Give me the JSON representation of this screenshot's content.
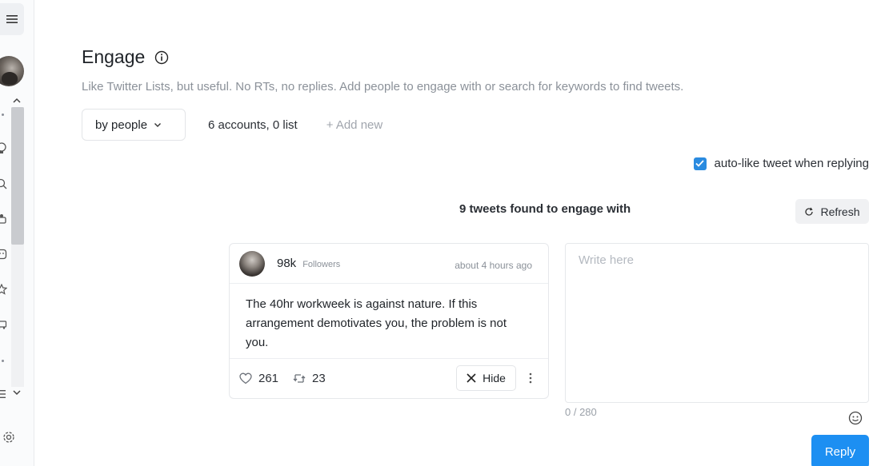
{
  "sidebar": {
    "menu_icon": "hamburger-icon",
    "icons": [
      "lightbulb-icon",
      "search-icon",
      "users-icon",
      "smile-icon",
      "star-icon",
      "truck-icon",
      "list-icon",
      "gear-icon"
    ]
  },
  "page": {
    "title": "Engage",
    "subtitle": "Like Twitter Lists, but useful. No RTs, no replies. Add people to engage with or search for keywords to find tweets."
  },
  "controls": {
    "filter_value": "by people",
    "accounts_summary": "6 accounts, 0 list",
    "add_new_label": "+ Add new"
  },
  "options": {
    "auto_like_label": "auto-like tweet when replying",
    "auto_like_checked": true
  },
  "results": {
    "found_label": "9 tweets found to engage with",
    "refresh_label": "Refresh"
  },
  "tweet": {
    "followers_count": "98k",
    "followers_label": "Followers",
    "time": "about 4 hours ago",
    "text": "The 40hr workweek is against nature. If this arrangement demotivates you, the problem is not you.",
    "likes": "261",
    "retweets": "23",
    "hide_label": "Hide"
  },
  "reply": {
    "placeholder": "Write here",
    "char_count": "0 / 280",
    "submit_label": "Reply"
  },
  "colors": {
    "accent": "#1d8ff2",
    "checkbox": "#2a8be0",
    "muted_text": "#8b9199"
  }
}
